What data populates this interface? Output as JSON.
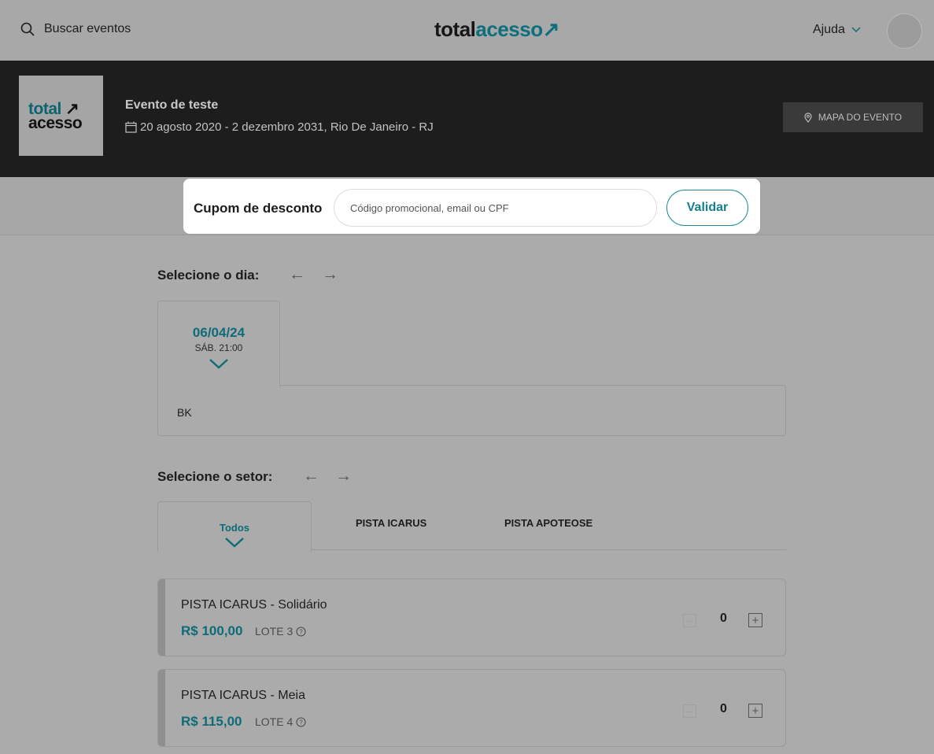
{
  "header": {
    "search_label": "Buscar eventos",
    "logo_part1": "total",
    "logo_part2": "acesso",
    "logo_arrow": "↗",
    "help_label": "Ajuda"
  },
  "event": {
    "logo_line1": "total",
    "logo_arrow": "↗",
    "logo_line2": "acesso",
    "title": "Evento de teste",
    "date_location": "20 agosto 2020 - 2 dezembro 2031, Rio De Janeiro - RJ",
    "map_button": "MAPA DO EVENTO"
  },
  "coupon": {
    "label": "Cupom de desconto",
    "placeholder": "Código promocional, email ou CPF",
    "validate_button": "Validar"
  },
  "day_section": {
    "heading": "Selecione o dia:",
    "selected_date": "06/04/24",
    "selected_time": "SÁB. 21:00",
    "panel_text": "BK"
  },
  "sector_section": {
    "heading": "Selecione o setor:",
    "tabs": [
      "Todos",
      "PISTA ICARUS",
      "PISTA APOTEOSE"
    ]
  },
  "tickets": [
    {
      "name": "PISTA ICARUS - Solidário",
      "price": "R$ 100,00",
      "lote": "LOTE 3",
      "qty": "0"
    },
    {
      "name": "PISTA ICARUS - Meia",
      "price": "R$ 115,00",
      "lote": "LOTE 4",
      "qty": "0"
    }
  ],
  "colors": {
    "accent": "#0e6c79",
    "banner": "#1d1d1d",
    "overlay": "#ababab"
  }
}
